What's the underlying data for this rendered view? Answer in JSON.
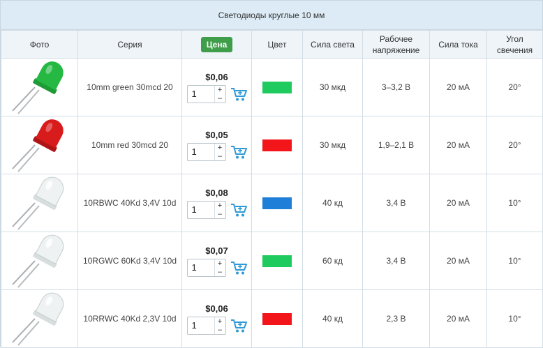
{
  "title": "Светодиоды круглые 10 мм",
  "columns": {
    "photo": "Фото",
    "series": "Серия",
    "price": "Цена",
    "color": "Цвет",
    "luminous": "Сила света",
    "voltage": "Рабочее напряжение",
    "current": "Сила тока",
    "angle": "Угол свечения"
  },
  "colors": {
    "accent_green": "#3f9e4a",
    "cart_blue": "#2f9ad6"
  },
  "rows": [
    {
      "led_color": "green",
      "series": "10mm green 30mcd 20",
      "price": "$0,06",
      "qty": "1",
      "swatch": "#1fca5e",
      "luminous": "30 мкд",
      "voltage": "3–3,2 В",
      "current": "20 мА",
      "angle": "20°"
    },
    {
      "led_color": "red",
      "series": "10mm red 30mcd 20",
      "price": "$0,05",
      "qty": "1",
      "swatch": "#f2161a",
      "luminous": "30 мкд",
      "voltage": "1,9–2,1 В",
      "current": "20 мА",
      "angle": "20°"
    },
    {
      "led_color": "clear",
      "series": "10RBWC 40Kd 3,4V 10d",
      "price": "$0,08",
      "qty": "1",
      "swatch": "#1f7ed8",
      "luminous": "40 кд",
      "voltage": "3,4 В",
      "current": "20 мА",
      "angle": "10°"
    },
    {
      "led_color": "clear",
      "series": "10RGWC 60Kd 3,4V 10d",
      "price": "$0,07",
      "qty": "1",
      "swatch": "#1fca5e",
      "luminous": "60 кд",
      "voltage": "3,4 В",
      "current": "20 мА",
      "angle": "10°"
    },
    {
      "led_color": "clear",
      "series": "10RRWC 40Kd 2,3V 10d",
      "price": "$0,06",
      "qty": "1",
      "swatch": "#f2161a",
      "luminous": "40 кд",
      "voltage": "2,3 В",
      "current": "20 мА",
      "angle": "10°"
    }
  ],
  "stepper": {
    "plus": "+",
    "minus": "–"
  },
  "icons": {
    "cart": "shopping-cart-icon"
  }
}
